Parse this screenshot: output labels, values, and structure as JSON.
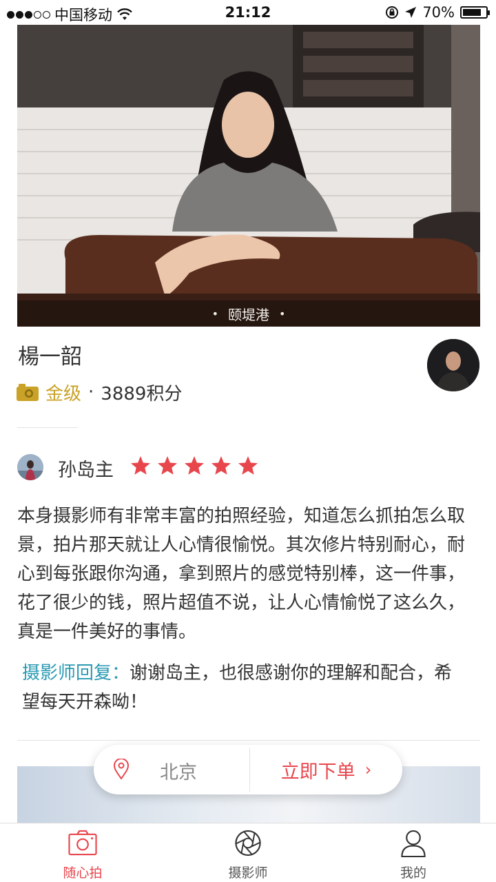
{
  "status_bar": {
    "carrier": "中国移动",
    "time": "21:12",
    "battery": "70%"
  },
  "hero": {
    "location": "颐堤港"
  },
  "photographer": {
    "name": "楊一韶",
    "level": "金级",
    "points": "3889积分"
  },
  "review": {
    "reviewer": "孙岛主",
    "rating": 5,
    "text": "本身摄影师有非常丰富的拍照经验，知道怎么抓拍怎么取景，拍片那天就让人心情很愉悦。其次修片特别耐心，耐心到每张跟你沟通，拿到照片的感觉特别棒，这一件事，花了很少的钱，照片超值不说，让人心情愉悦了这么久，真是一件美好的事情。",
    "reply_label": "摄影师回复：",
    "reply_text": "谢谢岛主，也很感谢你的理解和配合，希望每天开森呦！"
  },
  "action": {
    "city": "北京",
    "order_label": "立即下单",
    "chevron": "›"
  },
  "tabs": [
    {
      "label": "随心拍",
      "icon": "camera-icon",
      "active": true
    },
    {
      "label": "摄影师",
      "icon": "aperture-icon",
      "active": false
    },
    {
      "label": "我的",
      "icon": "user-icon",
      "active": false
    }
  ],
  "colors": {
    "accent": "#e8464d",
    "gold": "#c9a227",
    "reply": "#2a9ab3"
  }
}
